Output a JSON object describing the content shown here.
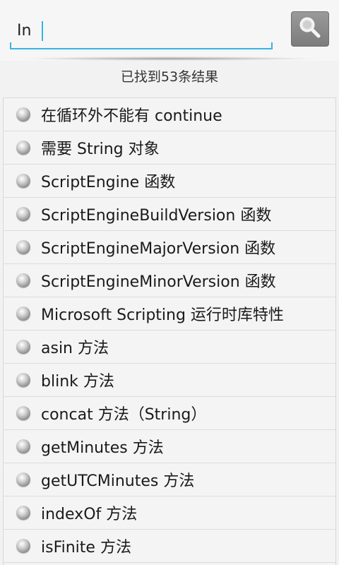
{
  "search": {
    "value": "In",
    "button_icon": "search-icon"
  },
  "result_count": "已找到53条结果",
  "results": [
    {
      "label": "在循环外不能有 continue"
    },
    {
      "label": "需要 String 对象"
    },
    {
      "label": "ScriptEngine 函数"
    },
    {
      "label": "ScriptEngineBuildVersion 函数"
    },
    {
      "label": "ScriptEngineMajorVersion 函数"
    },
    {
      "label": "ScriptEngineMinorVersion 函数"
    },
    {
      "label": "Microsoft Scripting 运行时库特性"
    },
    {
      "label": "asin 方法"
    },
    {
      "label": "blink 方法"
    },
    {
      "label": "concat 方法（String）"
    },
    {
      "label": "getMinutes 方法"
    },
    {
      "label": "getUTCMinutes 方法"
    },
    {
      "label": "indexOf 方法"
    },
    {
      "label": "isFinite 方法"
    }
  ],
  "colors": {
    "accent": "#33b5e5",
    "search_button": "#8a8a8a"
  }
}
